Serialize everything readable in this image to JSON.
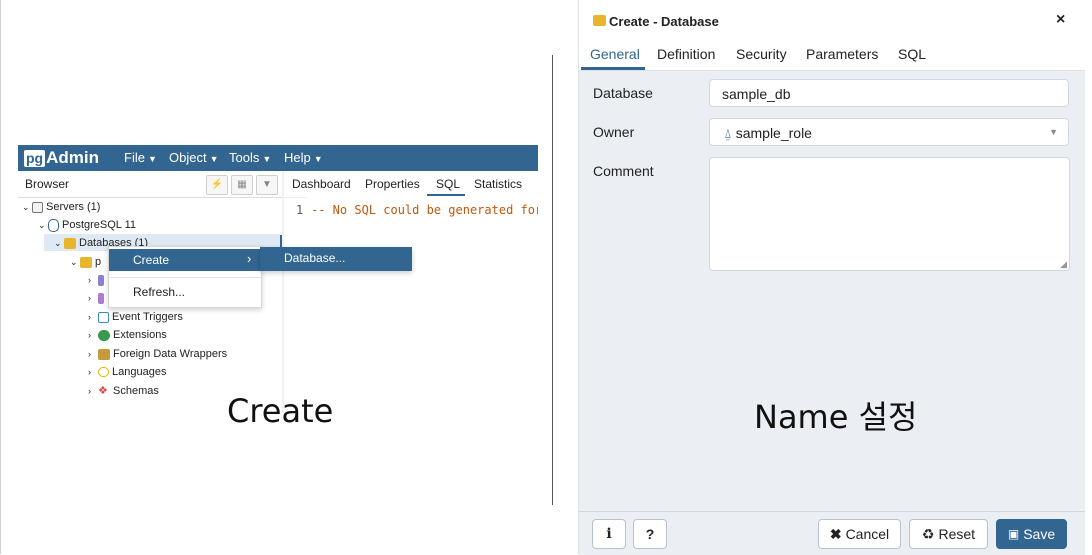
{
  "pgadmin": {
    "logo": {
      "pg": "pg",
      "admin": "Admin"
    },
    "menu": [
      "File",
      "Object",
      "Tools",
      "Help"
    ],
    "browser_label": "Browser",
    "tabs": [
      "Dashboard",
      "Properties",
      "SQL",
      "Statistics"
    ],
    "sql_line_number": "1",
    "sql_text": "-- No SQL could be generated for",
    "tree": {
      "servers": "Servers (1)",
      "postgres": "PostgreSQL 11",
      "databases": "Databases (1)",
      "db_prefix": "p",
      "event_triggers": "Event Triggers",
      "extensions": "Extensions",
      "fdw": "Foreign Data Wrappers",
      "languages": "Languages",
      "schemas": "Schemas"
    },
    "context_menu": {
      "create": "Create",
      "refresh": "Refresh..."
    },
    "submenu": {
      "database": "Database..."
    }
  },
  "captions": {
    "left": "Create",
    "right": "Name 설정"
  },
  "dialog": {
    "title": "Create - Database",
    "close": "×",
    "tabs": [
      "General",
      "Definition",
      "Security",
      "Parameters",
      "SQL"
    ],
    "fields": {
      "database_label": "Database",
      "database_value": "sample_db",
      "owner_label": "Owner",
      "owner_value": "sample_role",
      "comment_label": "Comment"
    },
    "buttons": {
      "info": "i",
      "help": "?",
      "cancel": "Cancel",
      "reset": "Reset",
      "save": "Save"
    }
  },
  "colors": {
    "brand": "#326690",
    "db_icon": "#e8b62c",
    "dialog_bg": "#ebeef3"
  }
}
